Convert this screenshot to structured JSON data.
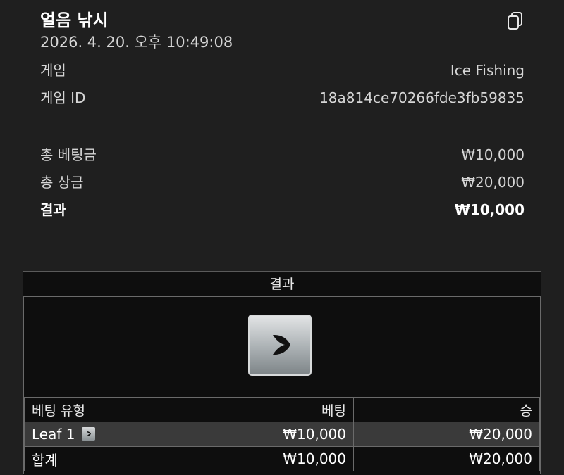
{
  "header": {
    "title": "얼음 낚시",
    "datetime": "2026. 4. 20. 오후 10:49:08",
    "copy_icon": "copy-icon"
  },
  "info": {
    "game_label": "게임",
    "game_value": "Ice Fishing",
    "game_id_label": "게임 ID",
    "game_id_value": "18a814ce70266fde3fb59835"
  },
  "summary": {
    "total_bet_label": "총 베팅금",
    "total_bet_value": "₩10,000",
    "total_prize_label": "총 상금",
    "total_prize_value": "₩20,000",
    "result_label": "결과",
    "result_value": "₩10,000"
  },
  "results": {
    "heading": "결과",
    "tile_icon": "leaf-result-icon",
    "columns": [
      "베팅 유형",
      "베팅",
      "승"
    ],
    "rows": [
      {
        "type": "Leaf 1",
        "bet": "₩10,000",
        "win": "₩20,000",
        "icon": "leaf-mini-icon"
      }
    ],
    "total": {
      "type": "합계",
      "bet": "₩10,000",
      "win": "₩20,000"
    }
  }
}
